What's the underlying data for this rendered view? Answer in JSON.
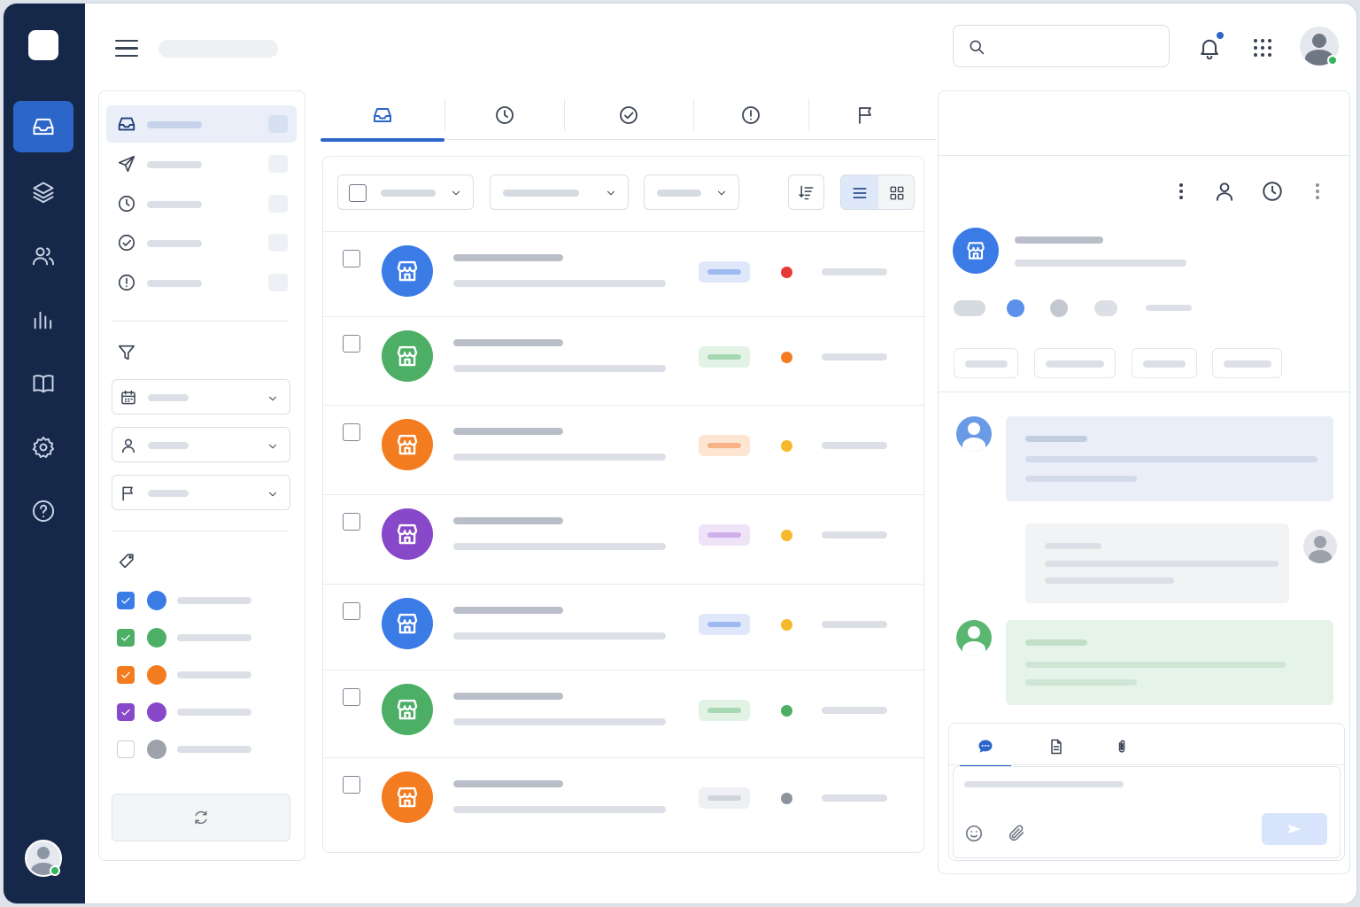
{
  "app": {
    "brand_color": "#15284a",
    "accent_color": "#2c66c9",
    "title": ""
  },
  "rail": {
    "items": [
      {
        "icon": "inbox-icon",
        "active": true
      },
      {
        "icon": "layers-icon",
        "active": false
      },
      {
        "icon": "users-icon",
        "active": false
      },
      {
        "icon": "bar-chart-icon",
        "active": false
      },
      {
        "icon": "book-icon",
        "active": false
      },
      {
        "icon": "settings-icon",
        "active": false
      },
      {
        "icon": "help-icon",
        "active": false
      }
    ],
    "user_status": "online"
  },
  "header": {
    "search": {
      "value": "",
      "placeholder": ""
    },
    "notifications": {
      "has_unread": true,
      "dot_color": "#2c66c9"
    },
    "apps_icon": "grid-icon",
    "user_status": "online"
  },
  "sidebar": {
    "folders": [
      {
        "icon": "inbox-icon",
        "active": true
      },
      {
        "icon": "send-icon",
        "active": false
      },
      {
        "icon": "clock-icon",
        "active": false
      },
      {
        "icon": "check-circle-icon",
        "active": false
      },
      {
        "icon": "alert-circle-icon",
        "active": false
      }
    ],
    "filter_icon": "filter-icon",
    "filters": [
      {
        "icon": "calendar-icon",
        "value": ""
      },
      {
        "icon": "user-icon",
        "value": ""
      },
      {
        "icon": "flag-icon",
        "value": ""
      }
    ],
    "tag_icon": "tag-icon",
    "labels": [
      {
        "checked": true,
        "color": "#3b7be6"
      },
      {
        "checked": true,
        "color": "#4caf65"
      },
      {
        "checked": true,
        "color": "#f47c20"
      },
      {
        "checked": true,
        "color": "#8748c9"
      },
      {
        "checked": false,
        "color": "#9ea3ab"
      }
    ],
    "refresh_icon": "refresh-icon"
  },
  "tabs": [
    {
      "icon": "inbox-icon",
      "active": true
    },
    {
      "icon": "clock-icon",
      "active": false
    },
    {
      "icon": "check-circle-icon",
      "active": false
    },
    {
      "icon": "alert-circle-icon",
      "active": false
    },
    {
      "icon": "flag-icon",
      "active": false
    }
  ],
  "list": {
    "toolbar": {
      "select_all": false,
      "sort_icon": "sort-icon",
      "view_mode": "list"
    },
    "rows": [
      {
        "avatar_color": "#3b7be6",
        "tag_color": "#dfe8fb",
        "tag_bar": "#9fbaf0",
        "status_color": "#e53935"
      },
      {
        "avatar_color": "#4caf65",
        "tag_color": "#e2f3e6",
        "tag_bar": "#a6d8b3",
        "status_color": "#f47c20"
      },
      {
        "avatar_color": "#f47c20",
        "tag_color": "#fde5d4",
        "tag_bar": "#f7b287",
        "status_color": "#f6b92b"
      },
      {
        "avatar_color": "#8748c9",
        "tag_color": "#efe3f8",
        "tag_bar": "#cfb0ea",
        "status_color": "#f6b92b"
      },
      {
        "avatar_color": "#3b7be6",
        "tag_color": "#dfe8fb",
        "tag_bar": "#9fbaf0",
        "status_color": "#f6b92b"
      },
      {
        "avatar_color": "#4caf65",
        "tag_color": "#e2f3e6",
        "tag_bar": "#a6d8b3",
        "status_color": "#4caf65"
      },
      {
        "avatar_color": "#f47c20",
        "tag_color": "#eef0f3",
        "tag_bar": "#cfd3da",
        "status_color": "#8d939c"
      }
    ]
  },
  "detail": {
    "actions": [
      "more-vertical-icon",
      "user-icon",
      "clock-icon",
      "more-vertical-icon"
    ],
    "avatar_color": "#3b7be6",
    "meta_dots": [
      "#d6dae1",
      "#5b91ea",
      "#c4c8cf",
      "#dcdfe5"
    ],
    "messages": [
      {
        "from": "agent",
        "bg": "#e9eef9",
        "avatar": "#6a9ae6"
      },
      {
        "from": "user",
        "bg": "#f2f3f5",
        "avatar": "#c9ccd2"
      },
      {
        "from": "customer",
        "bg": "#e5f3e8",
        "avatar": "#5bb672"
      }
    ],
    "composer": {
      "tabs": [
        "chat-icon",
        "note-icon",
        "attachment-icon"
      ],
      "active_tab": 0,
      "value": "",
      "placeholder": "",
      "emoji_icon": "emoji-icon",
      "attach_icon": "paperclip-icon",
      "send_icon": "send-icon"
    }
  }
}
